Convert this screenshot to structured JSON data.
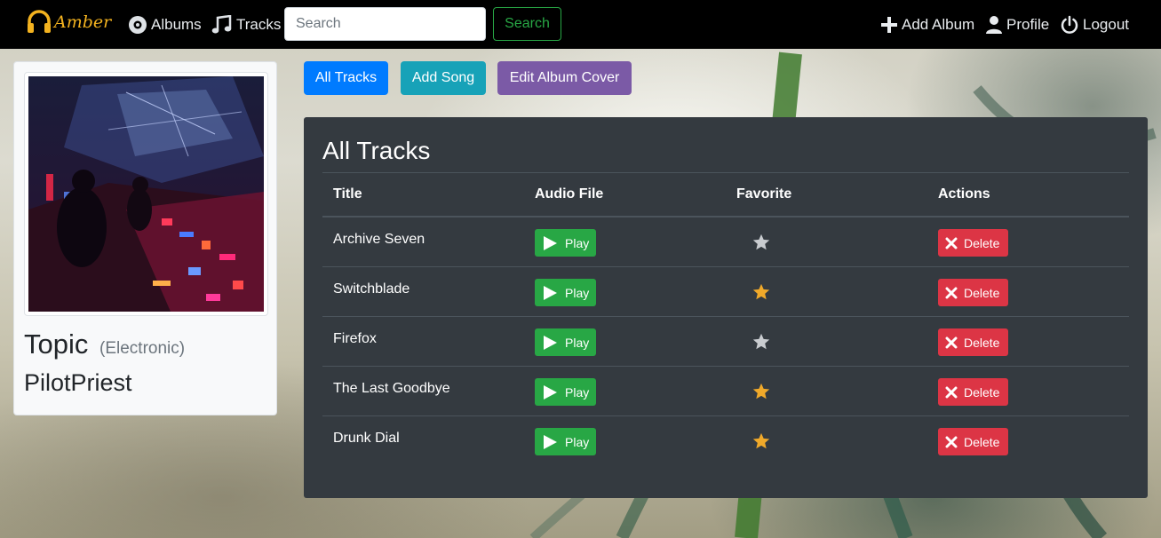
{
  "nav": {
    "brand": "Amber",
    "albums": "Albums",
    "tracks": "Tracks",
    "search_placeholder": "Search",
    "search_button": "Search",
    "add_album": "Add Album",
    "profile": "Profile",
    "logout": "Logout"
  },
  "album": {
    "title": "Topic",
    "genre": "(Electronic)",
    "artist": "PilotPriest"
  },
  "actions": {
    "all_tracks": "All Tracks",
    "add_song": "Add Song",
    "edit_cover": "Edit Album Cover"
  },
  "tracks_panel": {
    "heading": "All Tracks",
    "columns": [
      "Title",
      "Audio File",
      "Favorite",
      "Actions"
    ],
    "play_label": "Play",
    "delete_label": "Delete",
    "rows": [
      {
        "title": "Archive Seven",
        "favorite": false
      },
      {
        "title": "Switchblade",
        "favorite": true
      },
      {
        "title": "Firefox",
        "favorite": false
      },
      {
        "title": "The Last Goodbye",
        "favorite": true
      },
      {
        "title": "Drunk Dial",
        "favorite": true
      }
    ]
  },
  "colors": {
    "brand": "#f3b21f",
    "primary": "#007bff",
    "info": "#17a2b8",
    "purple": "#7b5aa6",
    "success": "#28a745",
    "danger": "#dc3545",
    "star_on": "#f0a92a",
    "star_off": "#c9ccd0"
  }
}
